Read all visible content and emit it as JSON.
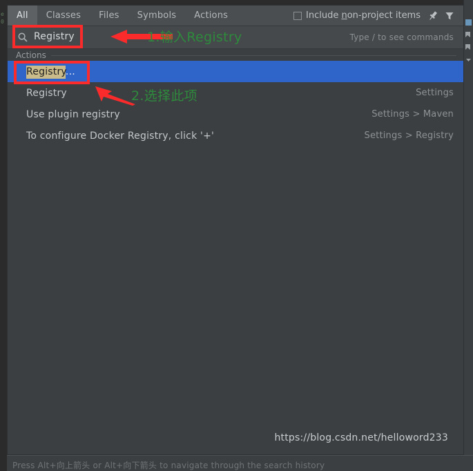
{
  "window": {
    "background_color": "#3c3f41",
    "accent_selected_color": "#2f65c9",
    "match_highlight_color": "#c9bc8a",
    "annotation_red": "#fb2b2b",
    "annotation_green": "#2e8b3d"
  },
  "tabs": [
    {
      "label": "All",
      "selected": true
    },
    {
      "label": "Classes",
      "selected": false
    },
    {
      "label": "Files",
      "selected": false
    },
    {
      "label": "Symbols",
      "selected": false
    },
    {
      "label": "Actions",
      "selected": false
    }
  ],
  "toolbar": {
    "include_non_project_label_before": "Include ",
    "include_non_project_underlined": "n",
    "include_non_project_label_after": "on-project items",
    "include_non_project_checked": false,
    "pin_icon": "pin-icon",
    "filter_icon": "filter-icon"
  },
  "search": {
    "icon": "search-icon",
    "value": "Registry",
    "hint": "Type / to see commands"
  },
  "results": {
    "group_header": "Actions",
    "rows": [
      {
        "match": "Registry",
        "rest": "...",
        "right": "",
        "selected": true
      },
      {
        "match": "",
        "rest": "Registry",
        "right": "Settings",
        "selected": false
      },
      {
        "match": "",
        "rest": "Use plugin registry",
        "right": "Settings > Maven",
        "selected": false
      },
      {
        "match": "",
        "rest": "To configure Docker Registry, click '+'",
        "right": "Settings > Registry",
        "selected": false
      }
    ]
  },
  "watermark": "https://blog.csdn.net/helloword233",
  "statusbar": {
    "text": "Press Alt+向上箭头 or Alt+向下箭头 to navigate through the search history"
  },
  "annotations": [
    {
      "name": "step-1",
      "text": "1.输入Registry"
    },
    {
      "name": "step-2",
      "text": "2.选择此项"
    }
  ],
  "background_gutter": {
    "lines": [
      "e",
      "0"
    ]
  }
}
